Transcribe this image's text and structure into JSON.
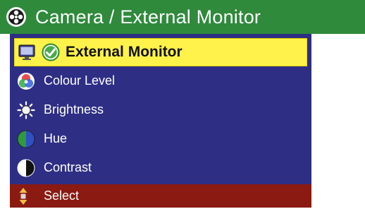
{
  "window": {
    "title": "Camera / External Monitor",
    "title_icon": "camera-lens-icon"
  },
  "menu": {
    "items": [
      {
        "label": "External Monitor",
        "icons": [
          "monitor-icon",
          "checkmark-circle-icon"
        ],
        "selected": true
      },
      {
        "label": "Colour Level",
        "icon": "colour-wheel-icon",
        "selected": false
      },
      {
        "label": "Brightness",
        "icon": "sun-icon",
        "selected": false
      },
      {
        "label": "Hue",
        "icon": "hue-circle-icon",
        "selected": false
      },
      {
        "label": "Contrast",
        "icon": "contrast-circle-icon",
        "selected": false
      }
    ]
  },
  "footer": {
    "label": "Select",
    "icon": "up-down-arrows-icon"
  },
  "colors": {
    "title_bar": "#2f8a3c",
    "menu_background": "#2e2e85",
    "selected_background": "#fff24a",
    "footer_background": "#8a1a12"
  }
}
